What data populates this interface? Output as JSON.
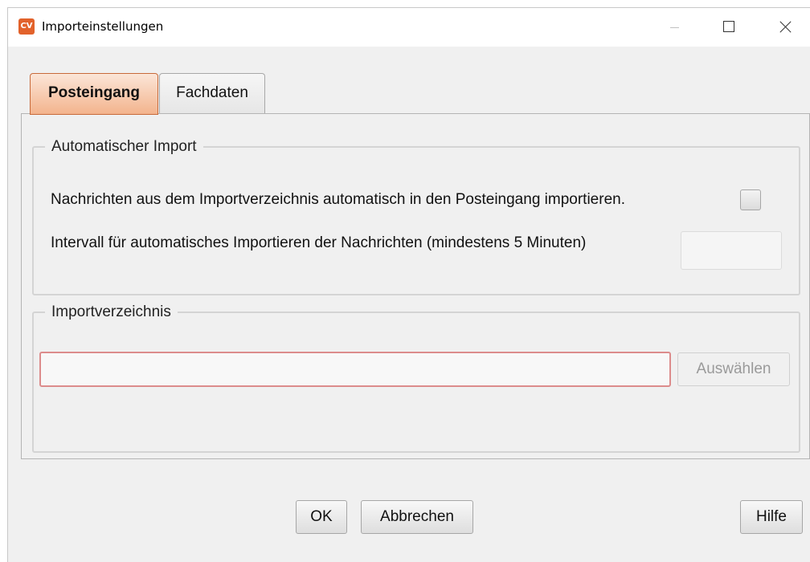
{
  "window": {
    "title": "Importeinstellungen",
    "icon_text": "CV",
    "icon_color": "#e2622b"
  },
  "tabs": [
    {
      "label": "Posteingang",
      "active": true
    },
    {
      "label": "Fachdaten",
      "active": false
    }
  ],
  "auto_import": {
    "legend": "Automatischer Import",
    "checkbox_label": "Nachrichten aus dem Importverzeichnis automatisch in den Posteingang importieren.",
    "checkbox_checked": false,
    "interval_label": "Intervall für automatisches Importieren der Nachrichten (mindestens 5 Minuten)",
    "interval_value": ""
  },
  "import_dir": {
    "legend": "Importverzeichnis",
    "path_value": "",
    "select_label": "Auswählen"
  },
  "footer": {
    "ok_label": "OK",
    "cancel_label": "Abbrechen",
    "help_label": "Hilfe"
  },
  "colors": {
    "active_tab_border": "#c86a3a",
    "invalid_input_border": "#dc8c8c"
  }
}
